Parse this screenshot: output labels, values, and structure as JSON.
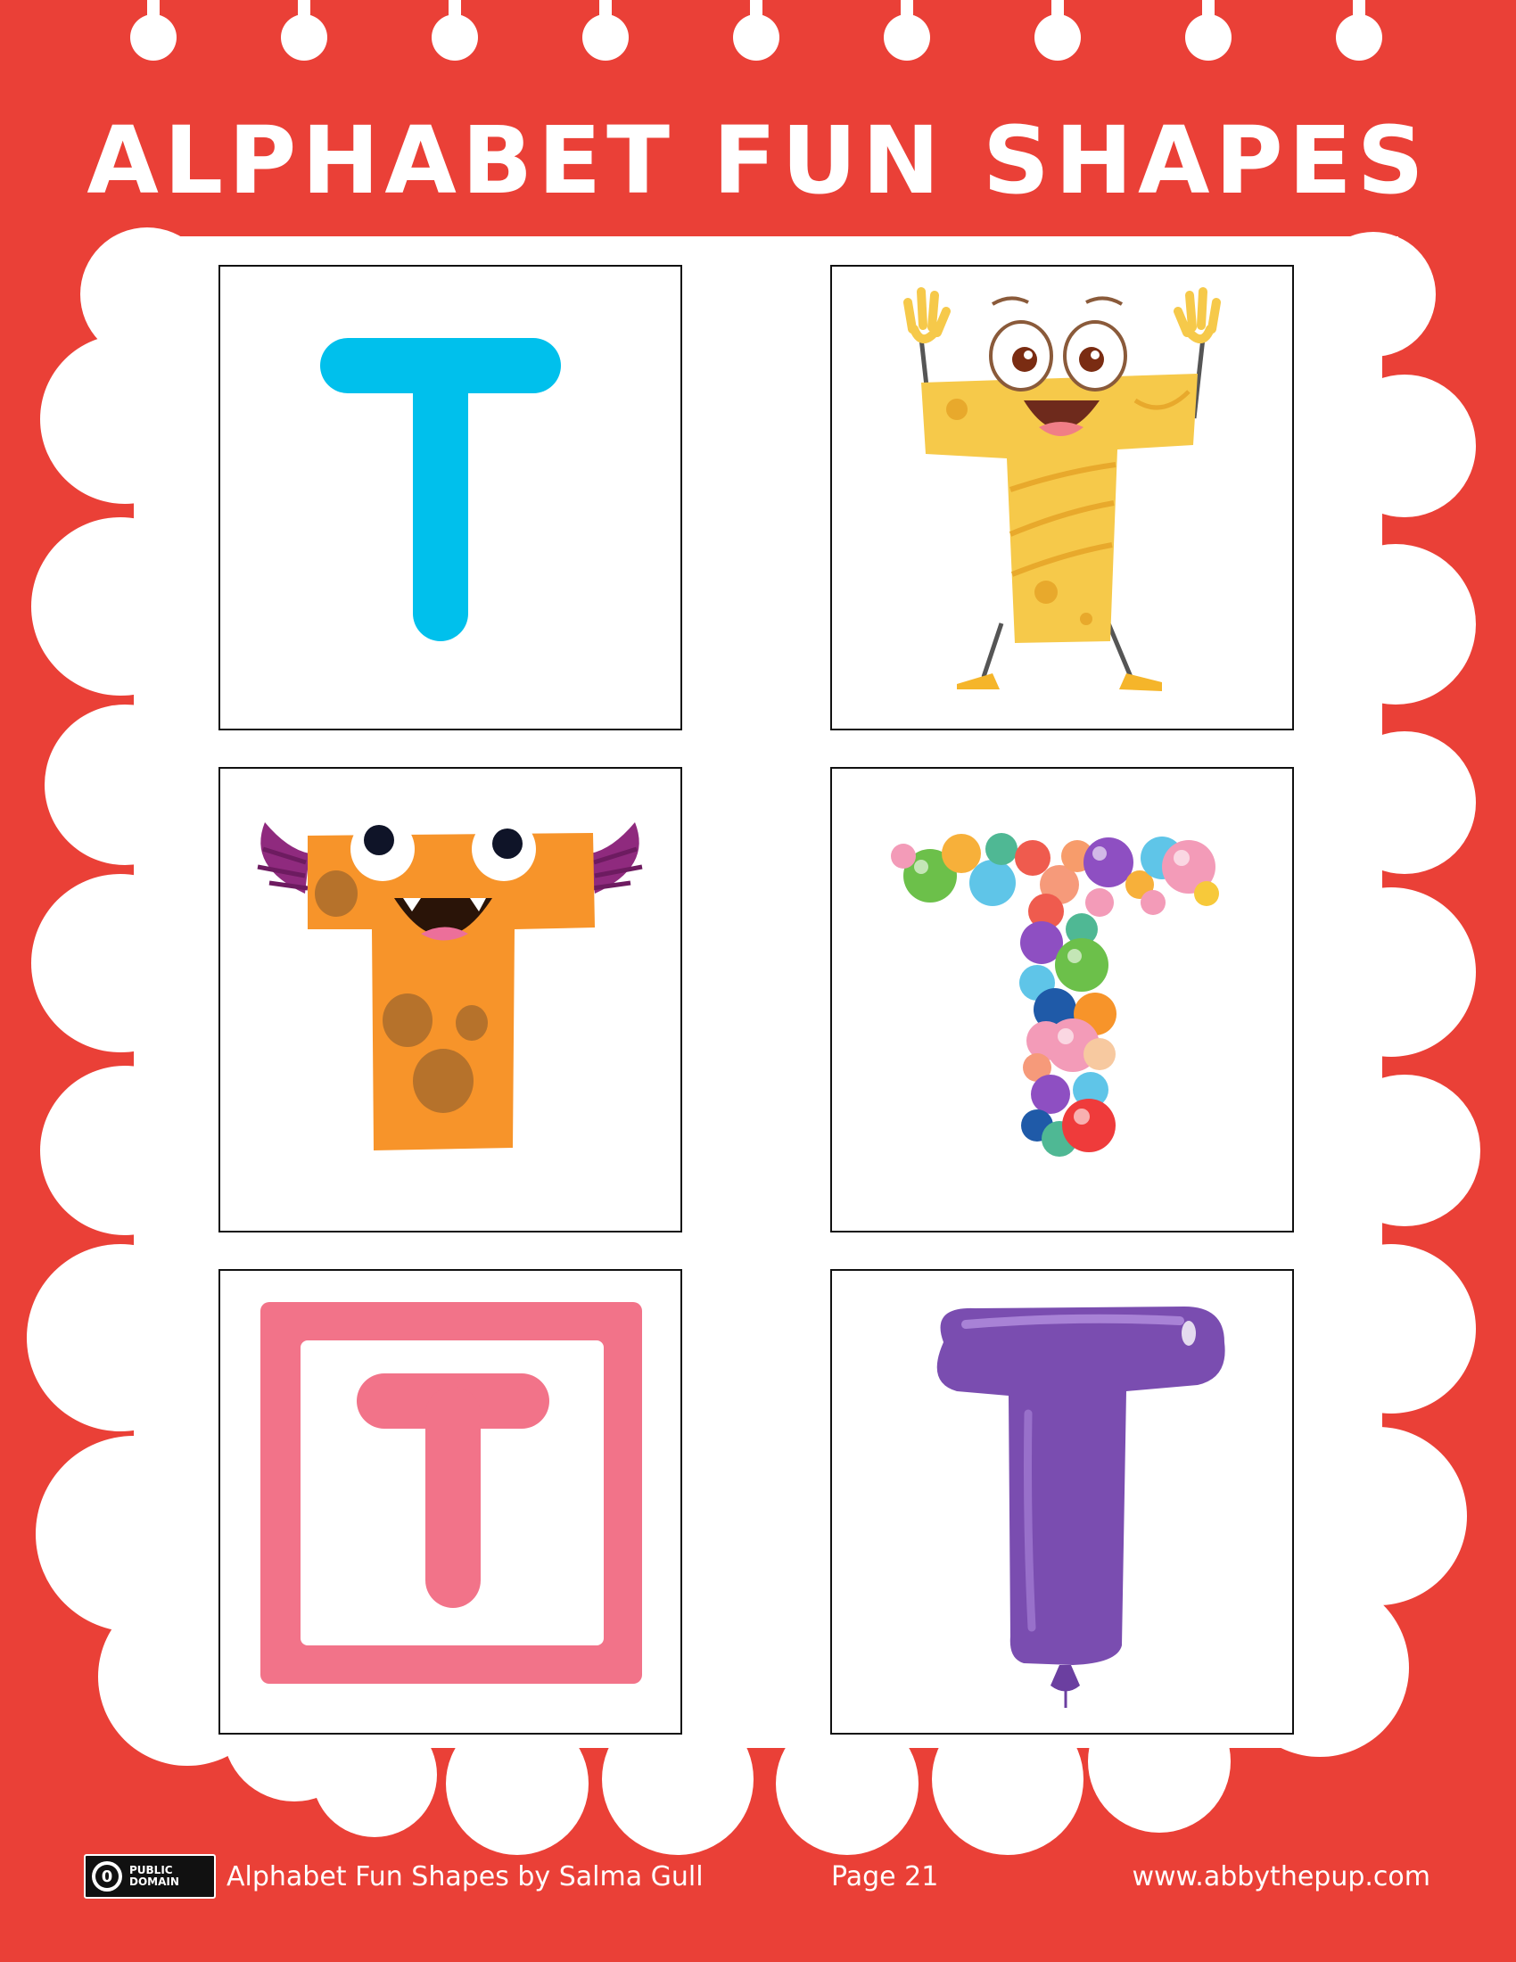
{
  "page": {
    "title": "ALPHABET FUN SHAPES",
    "background_color": "#ea4037"
  },
  "cards": [
    {
      "letter": "T",
      "style": "plain-blue-letter",
      "color": "#00c0ec"
    },
    {
      "letter": "T",
      "style": "cheese-character-letter",
      "color": "#f6c94a"
    },
    {
      "letter": "T",
      "style": "orange-monster-letter",
      "color": "#f7942a"
    },
    {
      "letter": "T",
      "style": "bubble-letter",
      "color": "#8e4fc2"
    },
    {
      "letter": "T",
      "style": "pink-framed-letter",
      "color": "#f27389"
    },
    {
      "letter": "T",
      "style": "purple-balloon-letter",
      "color": "#7a4db0"
    }
  ],
  "footer": {
    "license_icon": "public-domain-icon",
    "license_zero": "0",
    "license_line1": "PUBLIC",
    "license_line2": "DOMAIN",
    "credit": "Alphabet Fun Shapes by Salma Gull",
    "page_label": "Page 21",
    "website": "www.abbythepup.com"
  }
}
